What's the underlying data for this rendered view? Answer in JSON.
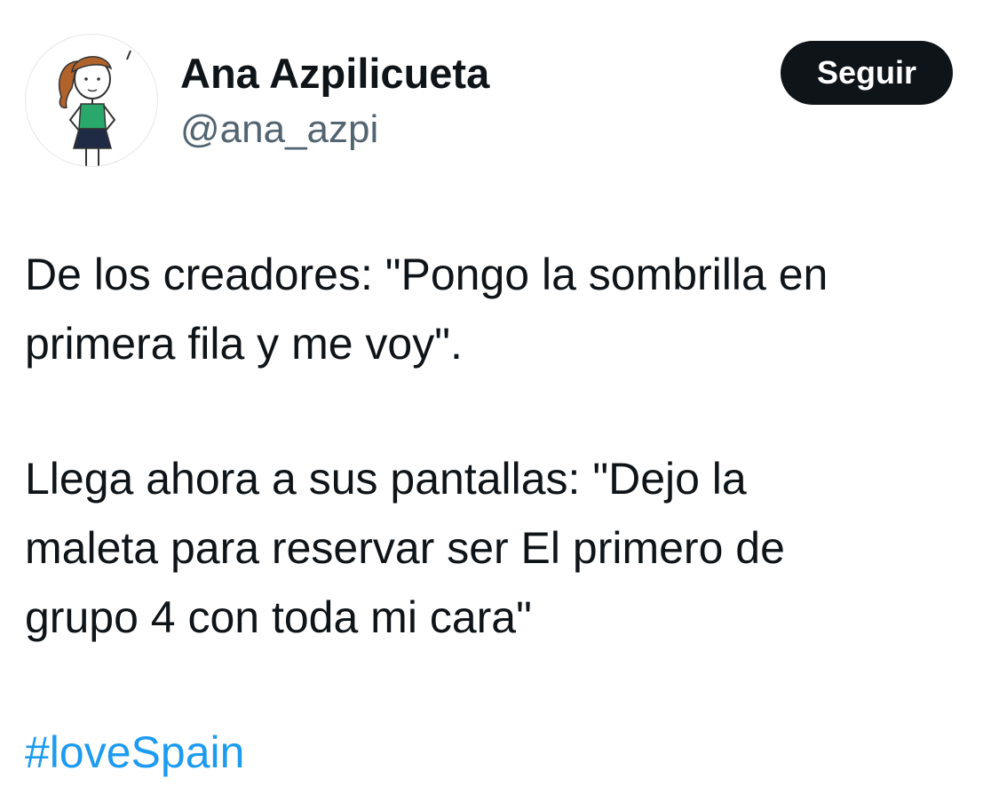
{
  "author": {
    "display_name": "Ana Azpilicueta",
    "handle": "@ana_azpi",
    "avatar_icon": "cartoon-woman-avatar"
  },
  "actions": {
    "follow_label": "Seguir"
  },
  "tweet": {
    "paragraph1_line1": "De los creadores: \"Pongo la sombrilla en",
    "paragraph1_line2": "primera fila y me voy\".",
    "paragraph2_line1": "Llega ahora a sus pantallas: \"Dejo la",
    "paragraph2_line2": "maleta para reservar ser El primero de",
    "paragraph2_line3": "grupo 4 con toda mi cara\"",
    "hashtag": "#loveSpain"
  },
  "colors": {
    "text": "#0f1419",
    "secondary_text": "#536471",
    "hashtag": "#1d9bf0",
    "button_bg": "#0f1419",
    "button_text": "#ffffff"
  }
}
